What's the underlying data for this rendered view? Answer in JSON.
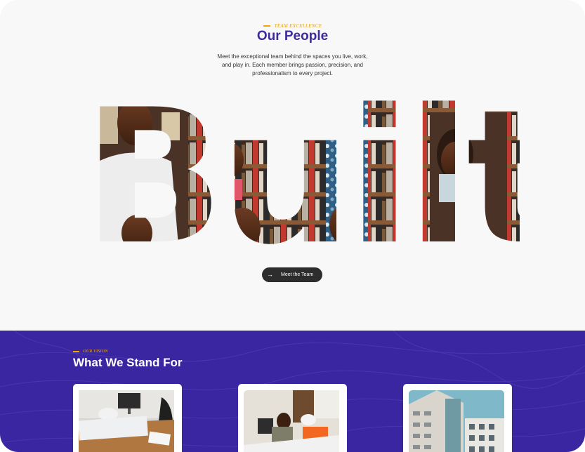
{
  "people": {
    "eyebrow": "TEAM EXCELLENCE",
    "title": "Our People",
    "description": "Meet the exceptional team behind the spaces you live, work, and play in. Each member brings passion, precision, and professionalism to every project.",
    "description_lines": [
      "Meet the exceptional team behind the spaces you live, work,",
      "and play in. Each member brings passion, precision, and",
      "professionalism to every project."
    ],
    "hero_word": "Built",
    "cta_label": "Meet the Team",
    "cta_icon": "arrow-right-icon"
  },
  "vision": {
    "eyebrow": "OUR VISION",
    "title": "What We Stand For",
    "cards": [
      {
        "image": "office-desk-photo"
      },
      {
        "image": "engineers-reviewing-plans-photo"
      },
      {
        "image": "apartment-building-photo"
      }
    ]
  },
  "colors": {
    "brand_purple": "#3f2a9f",
    "vision_bg": "#3a26a0",
    "accent_gold": "#f0a500",
    "cta_bg": "#2d2d2d"
  }
}
